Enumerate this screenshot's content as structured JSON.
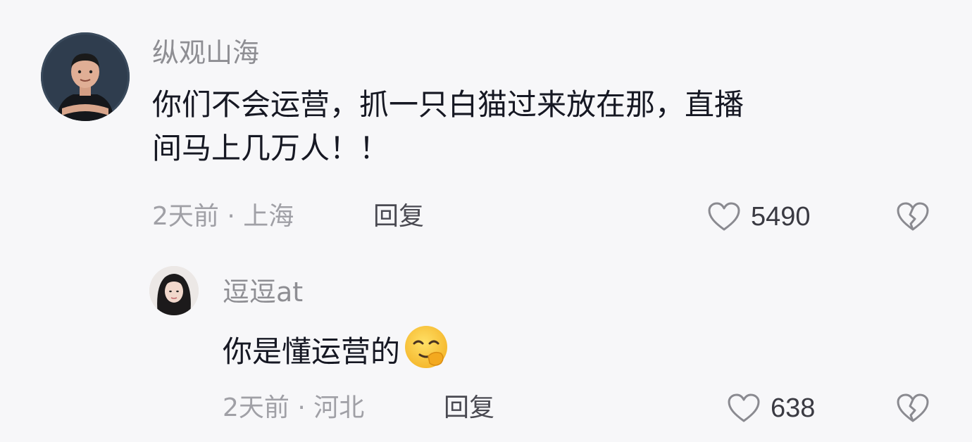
{
  "comments": [
    {
      "username": "纵观山海",
      "content_line1": "你们不会运营，抓一只白猫过来放在那，直播",
      "content_line2": "间马上几万人！！",
      "time_location": "2天前 · 上海",
      "reply_label": "回复",
      "likes": "5490",
      "avatar_icon": "man-avatar"
    },
    {
      "username": "逗逗at",
      "content": "你是懂运营的",
      "emoji": "smirk-face-emoji",
      "time_location": "2天前 · 河北",
      "reply_label": "回复",
      "likes": "638",
      "avatar_icon": "woman-avatar"
    }
  ],
  "icons": {
    "like": "heart-outline-icon",
    "dislike": "broken-heart-icon"
  },
  "colors": {
    "background": "#f7f7f9",
    "text": "#161823",
    "secondary": "#8e8e93"
  }
}
